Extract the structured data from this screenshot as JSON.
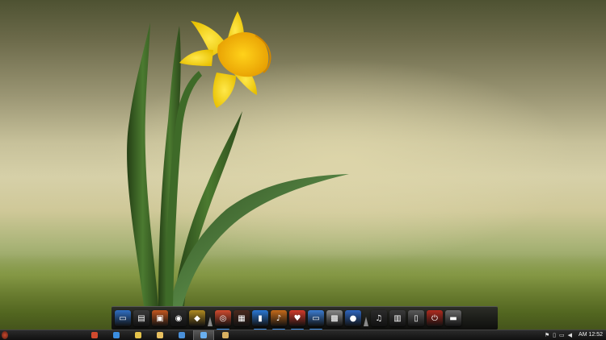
{
  "desktop": {
    "wallpaper": "daffodil-wallpaper",
    "colors": {
      "sky_top": "#4e5232",
      "sky_mid": "#d6d0a8",
      "grass": "#6f7f3c",
      "petal": "#f5d90a",
      "trumpet": "#f0b800",
      "leaf": "#3f6a2a"
    }
  },
  "dock": {
    "items": [
      {
        "name": "desktop-icon",
        "color": "#2f6fc4",
        "glyph": "▭",
        "indicator": false
      },
      {
        "name": "clipboard-icon",
        "color": "#3a3a3a",
        "glyph": "▤",
        "indicator": false
      },
      {
        "name": "slideshow-icon",
        "color": "#c2561f",
        "glyph": "▣",
        "indicator": false
      },
      {
        "name": "camera-icon",
        "color": "#2b2b2b",
        "glyph": "◉",
        "indicator": false
      },
      {
        "name": "sport-icon",
        "color": "#b08a20",
        "glyph": "◆",
        "indicator": false
      },
      {
        "name": "separator",
        "separator": true
      },
      {
        "name": "chrome-icon",
        "color": "#d14a2e",
        "glyph": "◎",
        "indicator": true
      },
      {
        "name": "calculator-icon",
        "color": "#4a2a1e",
        "glyph": "▦",
        "indicator": false
      },
      {
        "name": "usb-drive-icon",
        "color": "#2a78d4",
        "glyph": "▮",
        "indicator": true
      },
      {
        "name": "guitar-icon",
        "color": "#c46a1a",
        "glyph": "♪",
        "indicator": true
      },
      {
        "name": "cardiogram-icon",
        "color": "#d23a2a",
        "glyph": "♥",
        "indicator": true
      },
      {
        "name": "window-icon",
        "color": "#3b7cd1",
        "glyph": "▭",
        "indicator": true
      },
      {
        "name": "film-icon",
        "color": "#8a8a8a",
        "glyph": "▩",
        "indicator": false
      },
      {
        "name": "chat-icon",
        "color": "#2f66c0",
        "glyph": "●",
        "indicator": false
      },
      {
        "name": "separator",
        "separator": true
      },
      {
        "name": "music-notes-icon",
        "color": "#2b2b2b",
        "glyph": "♫",
        "indicator": false
      },
      {
        "name": "hdd-icon",
        "color": "#3a3a3a",
        "glyph": "▥",
        "indicator": false
      },
      {
        "name": "speakers-icon",
        "color": "#5a5a5a",
        "glyph": "▯",
        "indicator": false
      },
      {
        "name": "power-icon",
        "color": "#b02a1e",
        "glyph": "⏻",
        "indicator": false
      },
      {
        "name": "recycle-bin-icon",
        "color": "#6a6a6a",
        "glyph": "▬",
        "indicator": false
      }
    ]
  },
  "taskbar": {
    "start_label": "",
    "buttons": [
      {
        "name": "chrome-taskbar-icon",
        "color": "#d14a2e",
        "active": false
      },
      {
        "name": "ie-taskbar-icon",
        "color": "#3b8ee0",
        "active": false
      },
      {
        "name": "notes-taskbar-icon",
        "color": "#e3c24a",
        "active": false
      },
      {
        "name": "folder-taskbar-icon",
        "color": "#e8c060",
        "active": false
      },
      {
        "name": "paint-taskbar-icon",
        "color": "#4a90d9",
        "active": false
      },
      {
        "name": "snip-taskbar-icon",
        "color": "#6ab0f0",
        "active": true
      },
      {
        "name": "viewer-taskbar-icon",
        "color": "#d8b060",
        "active": false
      }
    ],
    "tray": {
      "icons": [
        "flag-icon",
        "network-icon",
        "monitor-icon",
        "volume-icon"
      ],
      "clock": "AM 12:52"
    }
  }
}
